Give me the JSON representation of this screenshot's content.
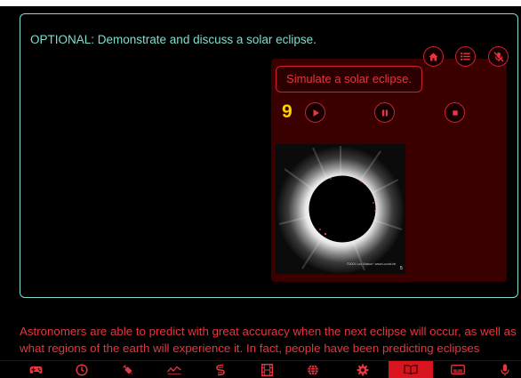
{
  "lesson": {
    "instruction": "OPTIONAL: Demonstrate and discuss a solar eclipse.",
    "narration": "Astronomers are able to predict with great accuracy when the next eclipse will occur, as well as what regions of the earth will experience it. In fact, people have been predicting eclipses"
  },
  "simulation": {
    "label": "Simulate a solar eclipse.",
    "countdown": "9",
    "image_credit": "©2001 Luc Viatour / www.Lucnix.be",
    "frame_number": "5"
  },
  "top_controls": [
    "home-icon",
    "list-icon",
    "microphone-off-icon"
  ],
  "playback_controls": [
    "play-icon",
    "pause-icon",
    "stop-icon"
  ],
  "nav_items": [
    {
      "icon": "gamepad-icon",
      "active": false
    },
    {
      "icon": "clock-icon",
      "active": false
    },
    {
      "icon": "syringe-icon",
      "active": false
    },
    {
      "icon": "chart-line-icon",
      "active": false
    },
    {
      "icon": "coil-icon",
      "active": false
    },
    {
      "icon": "film-icon",
      "active": false
    },
    {
      "icon": "globe-icon",
      "active": false
    },
    {
      "icon": "gear-icon",
      "active": false
    },
    {
      "icon": "book-open-icon",
      "active": true
    },
    {
      "icon": "caption-icon",
      "active": false
    },
    {
      "icon": "microphone-icon",
      "active": false
    }
  ],
  "colors": {
    "accent_red": "#e8353f",
    "instruction_teal": "#7fded0",
    "countdown_yellow": "#ffd500",
    "active_tab": "#d8141f"
  }
}
